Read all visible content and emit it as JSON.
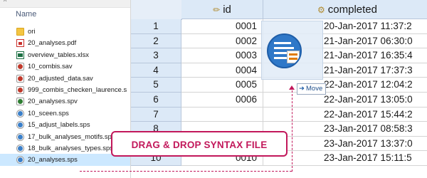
{
  "explorer": {
    "column_header": "Name",
    "files": [
      {
        "name": "ori",
        "icon": "folder-icon",
        "kind": "folder"
      },
      {
        "name": "20_analyses.pdf",
        "icon": "pdf-file-icon",
        "kind": "pdf"
      },
      {
        "name": "overview_tables.xlsx",
        "icon": "excel-file-icon",
        "kind": "xlsx"
      },
      {
        "name": "10_combis.sav",
        "icon": "spss-data-file-icon",
        "kind": "sav"
      },
      {
        "name": "20_adjusted_data.sav",
        "icon": "spss-data-file-icon",
        "kind": "sav"
      },
      {
        "name": "999_combis_checken_laurence.s",
        "icon": "spss-data-file-icon",
        "kind": "sav"
      },
      {
        "name": "20_analyses.spv",
        "icon": "spss-output-file-icon",
        "kind": "spv"
      },
      {
        "name": "10_sceen.sps",
        "icon": "spss-syntax-file-icon",
        "kind": "sps"
      },
      {
        "name": "15_adjust_labels.sps",
        "icon": "spss-syntax-file-icon",
        "kind": "sps"
      },
      {
        "name": "17_bulk_analyses_motifs.sps",
        "icon": "spss-syntax-file-icon",
        "kind": "sps"
      },
      {
        "name": "18_bulk_analyses_types.sps",
        "icon": "spss-syntax-file-icon",
        "kind": "sps"
      },
      {
        "name": "20_analyses.sps",
        "icon": "spss-syntax-file-icon",
        "kind": "sps",
        "selected": true
      }
    ]
  },
  "grid": {
    "columns": [
      {
        "name": "id",
        "icon": "ruler-icon"
      },
      {
        "name": "completed",
        "icon": "scale-icon"
      }
    ],
    "rows": [
      {
        "num": "1",
        "id": "0001",
        "completed": "20-Jan-2017 11:37:2"
      },
      {
        "num": "2",
        "id": "0002",
        "completed": "21-Jan-2017 06:30:0"
      },
      {
        "num": "3",
        "id": "0003",
        "completed": "21-Jan-2017 16:35:4"
      },
      {
        "num": "4",
        "id": "0004",
        "completed": "21-Jan-2017 17:37:3"
      },
      {
        "num": "5",
        "id": "0005",
        "completed": "22-Jan-2017 12:04:2"
      },
      {
        "num": "6",
        "id": "0006",
        "completed": "22-Jan-2017 13:05:0"
      },
      {
        "num": "7",
        "id": "",
        "completed": "22-Jan-2017 15:44:2"
      },
      {
        "num": "8",
        "id": "",
        "completed": "23-Jan-2017 08:58:3"
      },
      {
        "num": "9",
        "id": "",
        "completed": "23-Jan-2017 13:37:0"
      },
      {
        "num": "10",
        "id": "0010",
        "completed": "23-Jan-2017 15:11:5"
      }
    ]
  },
  "drag": {
    "tooltip_label": "Move",
    "tooltip_icon": "move-arrow-icon",
    "ghost_icon": "spss-syntax-file-icon"
  },
  "callout": {
    "text": "DRAG & DROP SYNTAX FILE"
  },
  "colors": {
    "accent": "#c2185b",
    "header_bg": "#dce9f7",
    "selection": "#cce8ff"
  }
}
